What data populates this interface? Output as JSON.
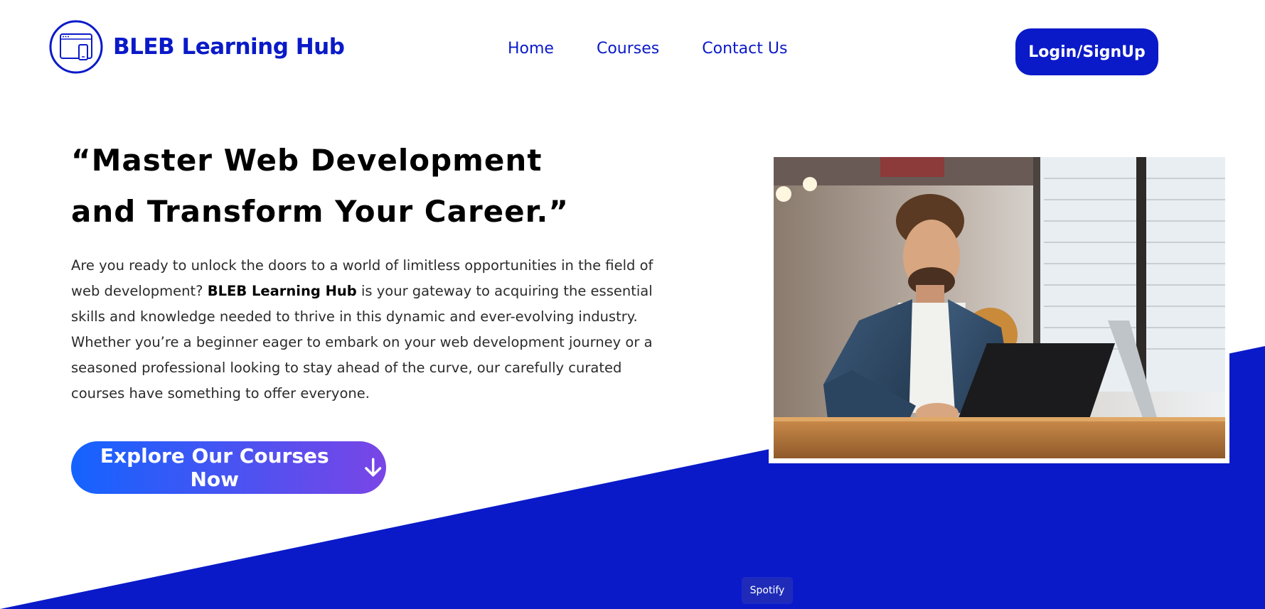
{
  "brand": {
    "name": "BLEB Learning Hub",
    "color": "#0a1ac8"
  },
  "nav": {
    "items": [
      {
        "label": "Home"
      },
      {
        "label": "Courses"
      },
      {
        "label": "Contact Us"
      }
    ]
  },
  "header": {
    "login_label": "Login/SignUp"
  },
  "hero": {
    "title_line1": "“Master Web Development",
    "title_line2": "and Transform Your Career.”",
    "desc_part1": "Are you ready to unlock the doors to a world of limitless opportunities in the field of web development? ",
    "desc_brand": "BLEB Learning Hub",
    "desc_part2": " is your gateway to acquiring the essential skills and knowledge needed to thrive in this dynamic and ever-evolving industry. Whether you’re a beginner eager to embark on your web development journey or a seasoned professional looking to stay ahead of the curve, our carefully curated courses have something to offer everyone.",
    "cta_label": "Explore Our Courses Now",
    "cta_icon": "arrow-down-icon",
    "image_subject": "man working on laptop"
  },
  "tooltip": {
    "label": "Spotify"
  },
  "colors": {
    "primary": "#0a1ac8",
    "gradient_start": "#1463ff",
    "gradient_end": "#7a45e6",
    "text": "#2b2b2b"
  }
}
